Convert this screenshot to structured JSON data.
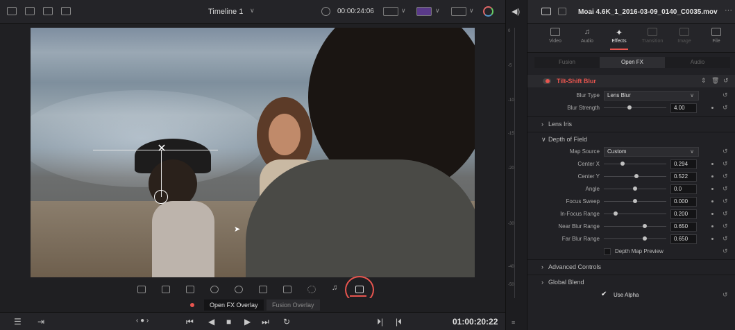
{
  "viewer": {
    "timeline_title": "Timeline 1",
    "timecode_top": "00:00:24:06",
    "overlay_tabs": [
      "Open FX Overlay",
      "Fusion Overlay"
    ],
    "playback_timecode": "01:00:20:22"
  },
  "meter": {
    "labels": [
      "0",
      "-5",
      "-10",
      "-15",
      "-20",
      "-30",
      "-40",
      "-50"
    ]
  },
  "inspector": {
    "clip_name": "Moai 4.6K_1_2016-03-09_0140_C0035.mov",
    "tabs": [
      "Video",
      "Audio",
      "Effects",
      "Transition",
      "Image",
      "File"
    ],
    "subtabs": [
      "Fusion",
      "Open FX",
      "Audio"
    ],
    "effect_name": "Tilt-Shift Blur",
    "blur_type_label": "Blur Type",
    "blur_type_value": "Lens Blur",
    "blur_strength_label": "Blur Strength",
    "blur_strength_value": "4.00",
    "lens_iris": "Lens Iris",
    "depth_of_field": "Depth of Field",
    "map_source_label": "Map Source",
    "map_source_value": "Custom",
    "params": [
      {
        "label": "Center X",
        "value": "0.294"
      },
      {
        "label": "Center Y",
        "value": "0.522"
      },
      {
        "label": "Angle",
        "value": "0.0"
      },
      {
        "label": "Focus Sweep",
        "value": "0.000"
      },
      {
        "label": "In-Focus Range",
        "value": "0.200"
      },
      {
        "label": "Near Blur Range",
        "value": "0.650"
      },
      {
        "label": "Far Blur Range",
        "value": "0.650"
      }
    ],
    "depth_map_preview": "Depth Map Preview",
    "advanced_controls": "Advanced Controls",
    "global_blend": "Global Blend",
    "use_alpha": "Use Alpha"
  },
  "colors": {
    "accent_red": "#e8554f",
    "highlight_circle": "#e8554f"
  },
  "icons": [
    "viewer-layout-icon",
    "audio-icon",
    "effects-wand-icon",
    "record-dot-icon",
    "play-icon",
    "stop-icon",
    "loop-icon",
    "reset-icon",
    "trash-icon"
  ]
}
